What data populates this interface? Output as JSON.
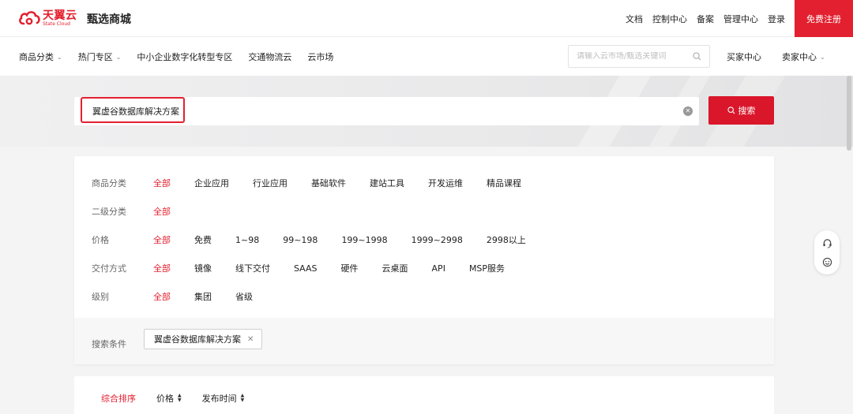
{
  "brand": {
    "logo_cn": "天翼云",
    "logo_en": "State Cloud",
    "title": "甄选商城"
  },
  "top_links": [
    "文档",
    "控制中心",
    "备案",
    "管理中心",
    "登录"
  ],
  "register_label": "免费注册",
  "nav": {
    "items": [
      {
        "label": "商品分类",
        "dropdown": true
      },
      {
        "label": "热门专区",
        "dropdown": true
      },
      {
        "label": "中小企业数字化转型专区",
        "dropdown": false
      },
      {
        "label": "交通物流云",
        "dropdown": false
      },
      {
        "label": "云市场",
        "dropdown": false
      }
    ],
    "search_placeholder": "请输入云市场/甄选关键词",
    "buyer_center": "买家中心",
    "seller_center": "卖家中心"
  },
  "search": {
    "value": "翼虚谷数据库解决方案",
    "button_label": "搜索"
  },
  "filters": [
    {
      "label": "商品分类",
      "options": [
        "全部",
        "企业应用",
        "行业应用",
        "基础软件",
        "建站工具",
        "开发运维",
        "精品课程"
      ],
      "active": 0
    },
    {
      "label": "二级分类",
      "options": [
        "全部"
      ],
      "active": 0
    },
    {
      "label": "价格",
      "options": [
        "全部",
        "免费",
        "1~98",
        "99~198",
        "199~1998",
        "1999~2998",
        "2998以上"
      ],
      "active": 0
    },
    {
      "label": "交付方式",
      "options": [
        "全部",
        "镜像",
        "线下交付",
        "SAAS",
        "硬件",
        "云桌面",
        "API",
        "MSP服务"
      ],
      "active": 0
    },
    {
      "label": "级别",
      "options": [
        "全部",
        "集团",
        "省级"
      ],
      "active": 0
    }
  ],
  "conditions": {
    "label": "搜索条件",
    "tag": "翼虚谷数据库解决方案"
  },
  "sort": {
    "items": [
      {
        "label": "综合排序",
        "arrows": false,
        "active": true
      },
      {
        "label": "价格",
        "arrows": true,
        "active": false
      },
      {
        "label": "发布时间",
        "arrows": true,
        "active": false
      }
    ]
  },
  "colors": {
    "brand_red": "#e3202f",
    "search_button": "#d9162a"
  }
}
